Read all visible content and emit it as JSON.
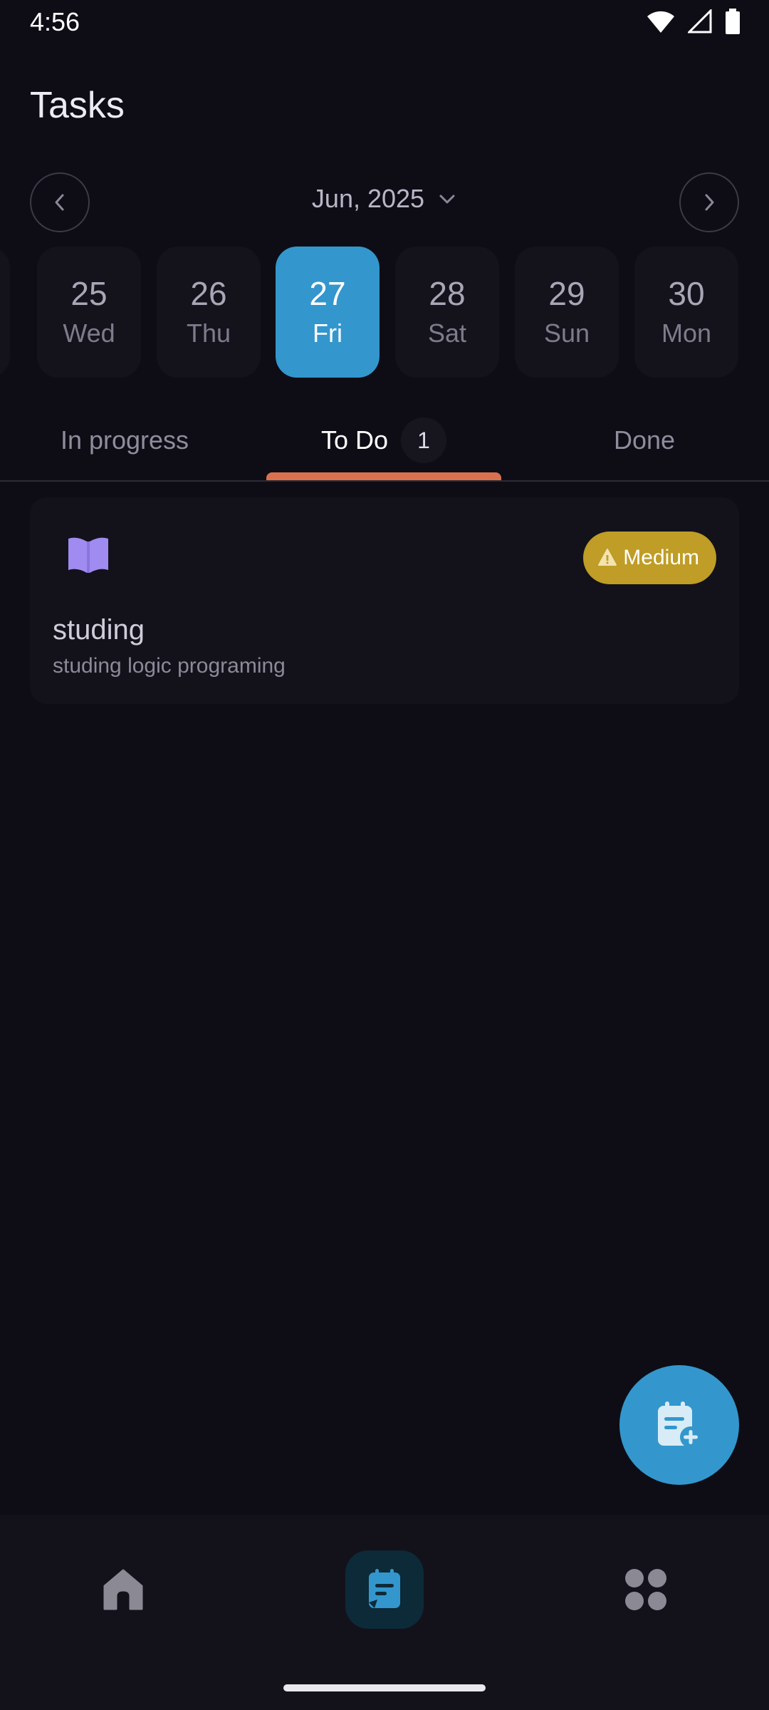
{
  "status_bar": {
    "time": "4:56"
  },
  "header": {
    "title": "Tasks"
  },
  "calendar": {
    "month_label": "Jun, 2025",
    "days": [
      {
        "num": "25",
        "dow": "Wed"
      },
      {
        "num": "26",
        "dow": "Thu"
      },
      {
        "num": "27",
        "dow": "Fri",
        "selected": true
      },
      {
        "num": "28",
        "dow": "Sat"
      },
      {
        "num": "29",
        "dow": "Sun"
      },
      {
        "num": "30",
        "dow": "Mon"
      }
    ]
  },
  "tabs": [
    {
      "label": "In progress"
    },
    {
      "label": "To Do",
      "count": "1",
      "active": true
    },
    {
      "label": "Done"
    }
  ],
  "tasks": [
    {
      "title": "studing",
      "description": "studing logic programing",
      "priority": "Medium",
      "icon": "book-icon"
    }
  ],
  "colors": {
    "background": "#0e0d16",
    "accent": "#3397cd",
    "tab_indicator": "#d9714f",
    "priority_medium": "#bf9d26",
    "book_icon": "#a08cf0"
  },
  "bottom_nav": [
    {
      "icon": "home-icon"
    },
    {
      "icon": "tasks-icon",
      "active": true
    },
    {
      "icon": "apps-grid-icon"
    }
  ]
}
